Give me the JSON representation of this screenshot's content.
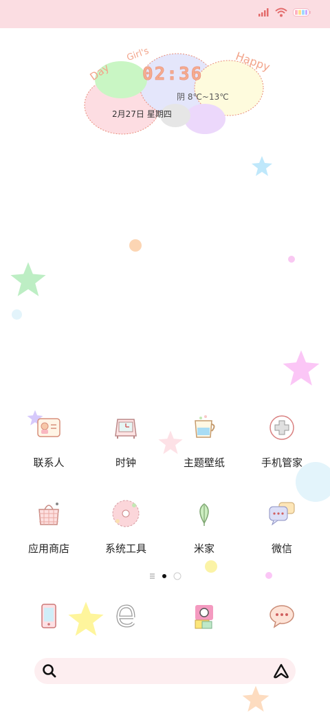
{
  "status_bar": {
    "icons": [
      "signal-icon",
      "wifi-icon",
      "battery-icon"
    ]
  },
  "widget": {
    "word_left": "Day",
    "word_mid": "Girl's",
    "word_right": "Happy",
    "time": "02:36",
    "weather": "阴 8℃~13℃",
    "date": "2月27日 星期四"
  },
  "apps": [
    {
      "label": "联系人",
      "icon": "contacts-icon"
    },
    {
      "label": "时钟",
      "icon": "clock-icon"
    },
    {
      "label": "主题壁纸",
      "icon": "themes-icon"
    },
    {
      "label": "手机管家",
      "icon": "security-icon"
    },
    {
      "label": "应用商店",
      "icon": "app-store-icon"
    },
    {
      "label": "系统工具",
      "icon": "tools-icon"
    },
    {
      "label": "米家",
      "icon": "mijia-icon"
    },
    {
      "label": "微信",
      "icon": "wechat-icon"
    }
  ],
  "pager": {
    "pages": 2,
    "current": 1
  },
  "dock": [
    {
      "icon": "phone-icon"
    },
    {
      "icon": "browser-icon"
    },
    {
      "icon": "camera-icon"
    },
    {
      "icon": "messages-icon"
    }
  ],
  "search": {
    "icons": [
      "search-icon",
      "assistant-icon"
    ]
  }
}
